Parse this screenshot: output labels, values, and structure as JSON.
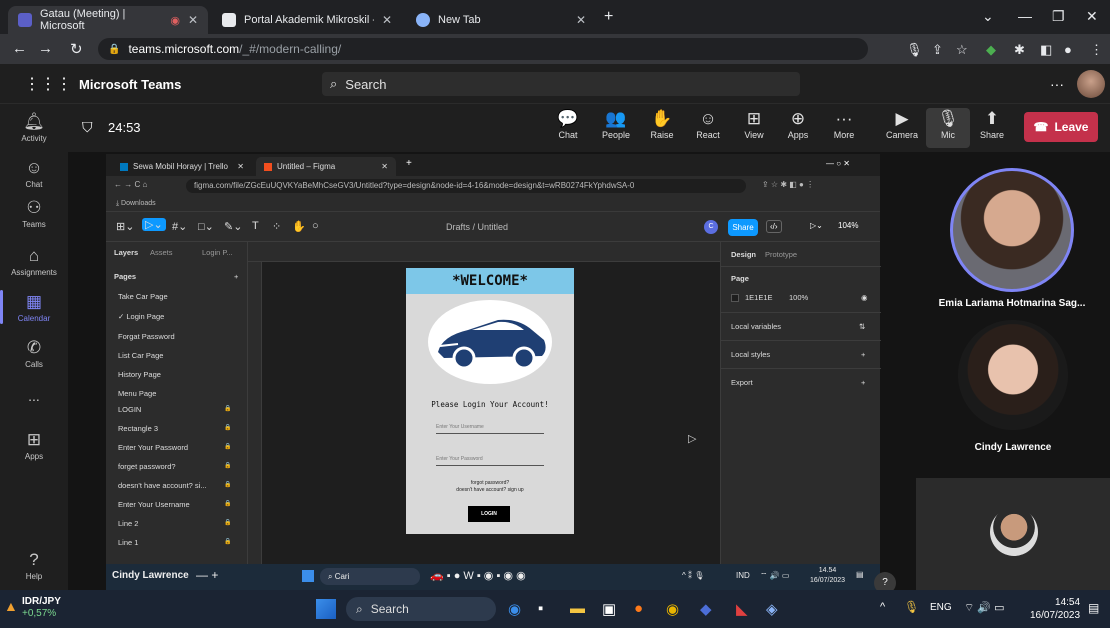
{
  "browser": {
    "tabs": [
      {
        "label": "Gatau (Meeting) | Microsoft",
        "active": true
      },
      {
        "label": "Portal Akademik Mikroskil - Kartu",
        "active": false
      },
      {
        "label": "New Tab",
        "active": false
      }
    ],
    "new_tab": "+",
    "url_host": "teams.microsoft.com",
    "url_path": "/_#/modern-calling/"
  },
  "teams": {
    "app_name": "Microsoft Teams",
    "search_placeholder": "Search",
    "rail": [
      {
        "label": "Activity",
        "icon": "bell-icon"
      },
      {
        "label": "Chat",
        "icon": "chat-icon"
      },
      {
        "label": "Teams",
        "icon": "teams-icon"
      },
      {
        "label": "Assignments",
        "icon": "assignments-icon"
      },
      {
        "label": "Calendar",
        "icon": "calendar-icon",
        "selected": true
      },
      {
        "label": "Calls",
        "icon": "phone-icon"
      },
      {
        "label": "...",
        "icon": "more-icon"
      },
      {
        "label": "Apps",
        "icon": "apps-icon"
      },
      {
        "label": "Help",
        "icon": "help-icon"
      }
    ]
  },
  "meeting": {
    "timer": "24:53",
    "controls": [
      {
        "label": "Chat",
        "glyph": "💬"
      },
      {
        "label": "People",
        "glyph": "👥"
      },
      {
        "label": "Raise",
        "glyph": "✋"
      },
      {
        "label": "React",
        "glyph": "☺"
      },
      {
        "label": "View",
        "glyph": "⊞"
      },
      {
        "label": "Apps",
        "glyph": "⊕"
      },
      {
        "label": "More",
        "glyph": "···"
      },
      {
        "label": "Camera",
        "glyph": "▶"
      },
      {
        "label": "Mic",
        "glyph": "🎙"
      },
      {
        "label": "Share",
        "glyph": "⬆"
      }
    ],
    "leave_label": "Leave",
    "participants": [
      {
        "name": "Emia Lariama Hotmarina Sag..."
      },
      {
        "name": "Cindy Lawrence"
      }
    ],
    "presenter_label": "Cindy Lawrence",
    "help_glyph": "?"
  },
  "shared_screen": {
    "tabs": [
      {
        "label": "Sewa Mobil Horayy | Trello"
      },
      {
        "label": "Untitled – Figma"
      }
    ],
    "url": "figma.com/file/ZGcEuUQVKYaBeMhCseGV3/Untitled?type=design&node-id=4-16&mode=design&t=wRB0274FkYphdwSA-0",
    "bookmark": "Downloads",
    "figma": {
      "file_title": "Drafts / Untitled",
      "share_label": "Share",
      "zoom": "104%",
      "left_tabs": [
        "Layers",
        "Assets",
        "Login P..."
      ],
      "pages_header": "Pages",
      "pages": [
        "Take Car Page",
        "✓ Login Page",
        "Forgat Password",
        "List Car Page",
        "History Page",
        "Menu Page"
      ],
      "layers": [
        "LOGIN",
        "Rectangle 3",
        "Enter Your Password",
        "forget password?",
        "doesn't have account? si...",
        "Enter Your Username",
        "Line 2",
        "Line 1"
      ],
      "right_tabs": [
        "Design",
        "Prototype"
      ],
      "page_label": "Page",
      "page_color": "1E1E1E",
      "page_opacity": "100%",
      "sections": [
        "Local variables",
        "Local styles",
        "Export"
      ],
      "frame": {
        "welcome": "*WELCOME*",
        "please": "Please Login Your Account!",
        "username_ph": "Enter Your Username",
        "password_ph": "Enter Your Password",
        "forgot": "forgot password?",
        "signup": "doesn't have account? sign up",
        "login_btn": "LOGIN"
      }
    },
    "taskbar": {
      "search": "Cari",
      "lang": "IND",
      "time": "14.54",
      "date": "16/07/2023"
    }
  },
  "windows": {
    "ticker_pair": "IDR/JPY",
    "ticker_change": "+0,57%",
    "search_placeholder": "Search",
    "lang": "ENG",
    "time": "14:54",
    "date": "16/07/2023"
  }
}
